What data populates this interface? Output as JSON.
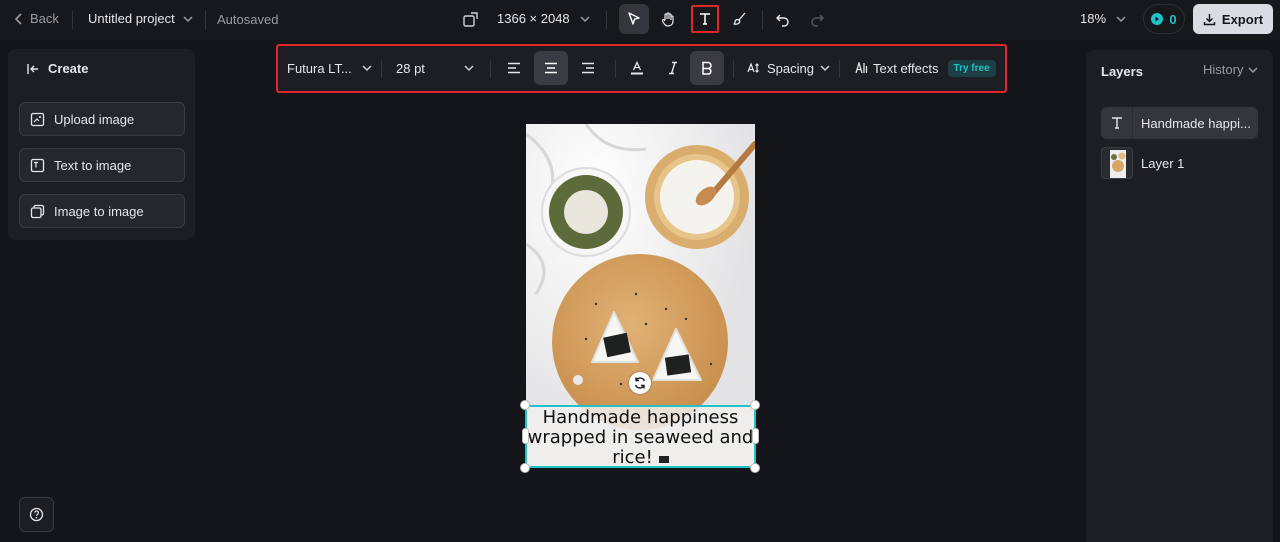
{
  "topbar": {
    "back_label": "Back",
    "project_name": "Untitled project",
    "autosave_status": "Autosaved",
    "canvas_size": "1366 × 2048",
    "zoom": "18%",
    "credits": "0",
    "export_label": "Export"
  },
  "text_toolbar": {
    "font": "Futura LT...",
    "size": "28 pt",
    "spacing_label": "Spacing",
    "effects_label": "Text effects",
    "effects_badge": "Try free"
  },
  "left_panel": {
    "create_label": "Create",
    "items": [
      {
        "label": "Upload image",
        "icon": "upload-image-icon"
      },
      {
        "label": "Text to image",
        "icon": "text-to-image-icon"
      },
      {
        "label": "Image to image",
        "icon": "image-to-image-icon"
      }
    ]
  },
  "canvas": {
    "text_line1": "Handmade happiness",
    "text_line2": "wrapped in seaweed and",
    "text_line3": "rice!"
  },
  "layers_panel": {
    "title": "Layers",
    "history_label": "History",
    "layers": [
      {
        "name": "Handmade happi...",
        "type": "text"
      },
      {
        "name": "Layer 1",
        "type": "image"
      }
    ]
  },
  "colors": {
    "accent": "#1fc2c6",
    "highlight_border": "#e0262a",
    "background": "#141519"
  }
}
